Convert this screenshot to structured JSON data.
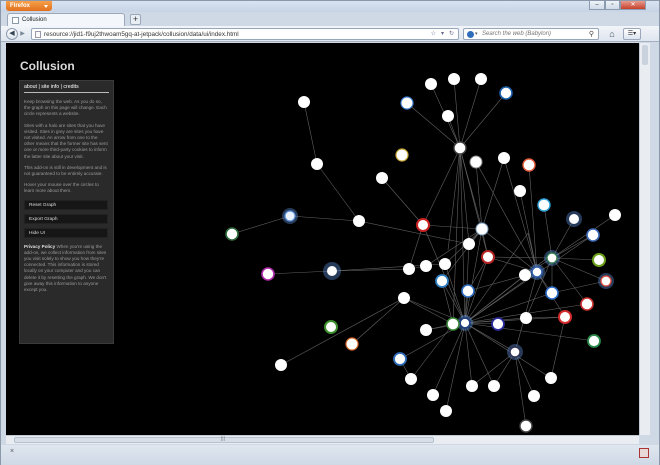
{
  "browser": {
    "menu_button": "Firefox",
    "tab_title": "Collusion",
    "new_tab": "+",
    "url": "resource://jid1-f9uj2thwoam5gq-at-jetpack/collusion/data/ui/index.html",
    "search_placeholder": "Search the web (Babylon)",
    "status_close": "×"
  },
  "app": {
    "title": "Collusion",
    "nav": {
      "about": "about",
      "site_info": "site info",
      "credits": "credits",
      "sep": "|"
    },
    "paragraphs": [
      "Keep browsing the web. As you do so, the graph on this page will change. Each circle represents a website.",
      "Sites with a halo are sites that you have visited. Sites in grey are sites you have not visited. An arrow from one to the other means that the former site has sent one or more third-party cookies to inform the latter site about your visit.",
      "This add-on is still in development and is not guaranteed to be entirely accurate.",
      "Hover your mouse over the circles to learn more about them."
    ],
    "buttons": {
      "reset": "Reset Graph",
      "export": "Export Graph",
      "hide": "Hide UI"
    },
    "privacy_title": "Privacy Policy",
    "privacy_text": "When you're using the add-on, we collect information from sites you visit solely to show you how they're connected. This information is stored locally on your computer and you can delete it by resetting the graph. We don't give away this information to anyone except you."
  }
}
